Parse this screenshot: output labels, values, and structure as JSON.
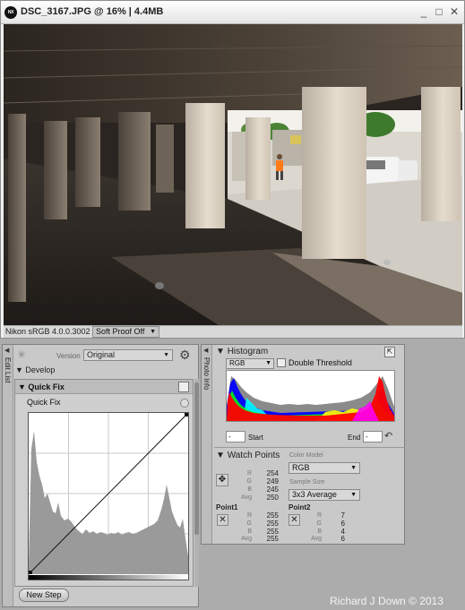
{
  "window": {
    "title": "DSC_3167.JPG @ 16% | 4.4MB",
    "app_icon": "nx-logo-icon",
    "app_icon_text": "NX",
    "controls": {
      "minimize": "_",
      "maximize": "□",
      "close": "✕"
    }
  },
  "statusbar": {
    "profile": "Nikon sRGB 4.0.0.3002",
    "soft_proof": "Soft Proof Off"
  },
  "edit_list": {
    "tab_label": "Edit List",
    "version_label": "Version",
    "version_value": "Original",
    "develop_label": "Develop",
    "quick_fix": {
      "title": "Quick Fix",
      "subtitle": "Quick Fix"
    },
    "new_step": "New Step"
  },
  "photo_info": {
    "tab_label": "Photo Info",
    "histogram": {
      "title": "Histogram",
      "channel": "RGB",
      "double_threshold": "Double Threshold",
      "start_value": "-",
      "start_label": "Start",
      "end_label": "End",
      "end_value": "-"
    },
    "watch_points": {
      "title": "Watch Points",
      "color_model_label": "Color Model",
      "color_model": "RGB",
      "sample_size_label": "Sample Size",
      "sample_size": "3x3 Average",
      "channel_labels": [
        "R",
        "G",
        "B",
        "Avg"
      ],
      "current": {
        "R": "254",
        "G": "249",
        "B": "245",
        "Avg": "250"
      },
      "point1": {
        "label": "Point1",
        "R": "255",
        "G": "255",
        "B": "255",
        "Avg": "255"
      },
      "point2": {
        "label": "Point2",
        "R": "7",
        "G": "6",
        "B": "4",
        "Avg": "6"
      }
    }
  },
  "credit": "Richard J Down © 2013",
  "colors": {
    "panel_bg": "#c9c9c9",
    "desktop_bg": "#acacac",
    "hist_red": "#ff0000",
    "hist_green": "#00ff00",
    "hist_blue": "#0000ff",
    "hist_cyan": "#00ffff",
    "hist_magenta": "#ff00ff",
    "hist_yellow": "#ffff00"
  }
}
